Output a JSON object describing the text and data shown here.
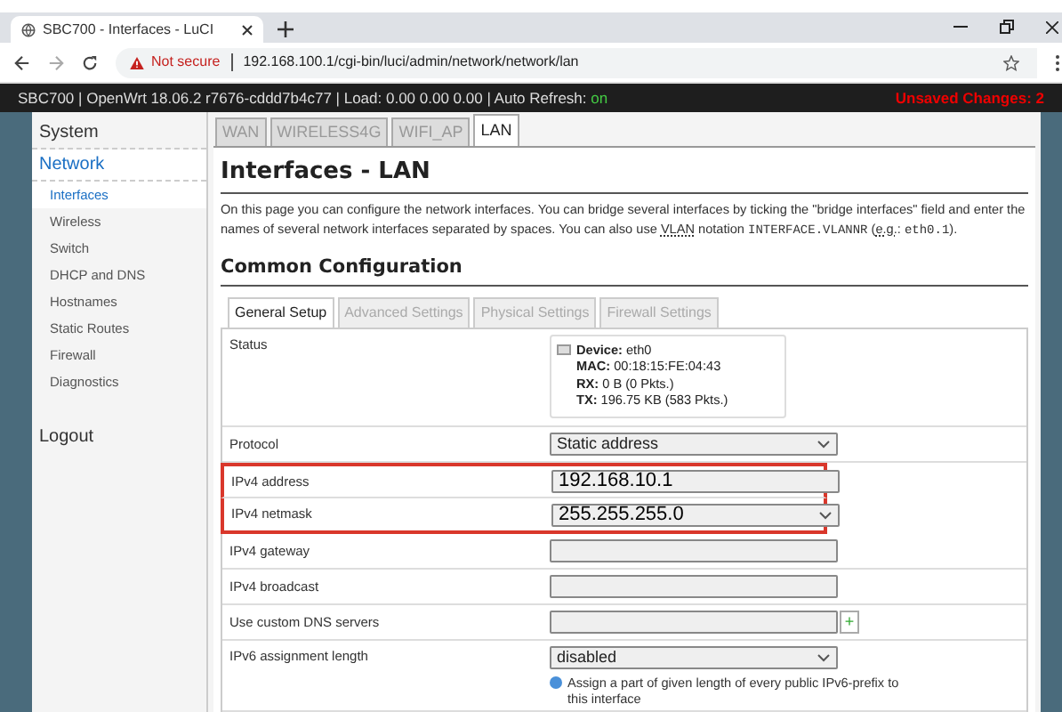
{
  "browser": {
    "tab_title": "SBC700 - Interfaces - LuCI",
    "security": "Not secure",
    "url": "192.168.100.1/cgi-bin/luci/admin/network/network/lan"
  },
  "header": {
    "info": "SBC700 | OpenWrt 18.06.2 r7676-cddd7b4c77 | Load: 0.00 0.00 0.00 | Auto Refresh: ",
    "auto_refresh": "on",
    "unsaved": "Unsaved Changes: 2"
  },
  "sidebar": {
    "items": [
      {
        "label": "System",
        "selected": false
      },
      {
        "label": "Network",
        "selected": true,
        "children": [
          {
            "label": "Interfaces",
            "selected": true
          },
          {
            "label": "Wireless",
            "selected": false
          },
          {
            "label": "Switch",
            "selected": false
          },
          {
            "label": "DHCP and DNS",
            "selected": false
          },
          {
            "label": "Hostnames",
            "selected": false
          },
          {
            "label": "Static Routes",
            "selected": false
          },
          {
            "label": "Firewall",
            "selected": false
          },
          {
            "label": "Diagnostics",
            "selected": false
          }
        ]
      }
    ],
    "logout": "Logout"
  },
  "interface_tabs": [
    {
      "label": "WAN",
      "selected": false
    },
    {
      "label": "WIRELESS4G",
      "selected": false
    },
    {
      "label": "WIFI_AP",
      "selected": false
    },
    {
      "label": "LAN",
      "selected": true
    }
  ],
  "title": "Interfaces - LAN",
  "description": [
    {
      "kind": "text",
      "text": "On this page you can configure the network interfaces. You can bridge several interfaces by ticking the \"bridge interfaces\" field and enter the names of several network interfaces separated by spaces. You can also use "
    },
    {
      "kind": "abbr",
      "text": "VLAN"
    },
    {
      "kind": "text",
      "text": " notation "
    },
    {
      "kind": "code",
      "text": "INTERFACE.VLANNR"
    },
    {
      "kind": "text",
      "text": " ("
    },
    {
      "kind": "abbr",
      "text": "e.g."
    },
    {
      "kind": "text",
      "text": ": "
    },
    {
      "kind": "code",
      "text": "eth0.1"
    },
    {
      "kind": "text",
      "text": ")."
    }
  ],
  "section_title": "Common Configuration",
  "section_tabs": [
    {
      "label": "General Setup",
      "selected": true
    },
    {
      "label": "Advanced Settings",
      "selected": false
    },
    {
      "label": "Physical Settings",
      "selected": false
    },
    {
      "label": "Firewall Settings",
      "selected": false
    }
  ],
  "status": {
    "label": "Status",
    "lines": [
      {
        "key": "Device:",
        "value": " eth0"
      },
      {
        "key": "MAC:",
        "value": " 00:18:15:FE:04:43"
      },
      {
        "key": "RX:",
        "value": " 0 B (0 Pkts.)"
      },
      {
        "key": "TX:",
        "value": " 196.75 KB (583 Pkts.)"
      }
    ]
  },
  "fields": [
    {
      "label": "Protocol",
      "kind": "select",
      "value": "Static address",
      "highlighted": false
    },
    {
      "label": "IPv4 address",
      "kind": "input",
      "value": "192.168.10.1",
      "highlighted": true
    },
    {
      "label": "IPv4 netmask",
      "kind": "select",
      "value": "255.255.255.0",
      "highlighted": true
    },
    {
      "label": "IPv4 gateway",
      "kind": "input",
      "highlighted": false
    },
    {
      "label": "IPv4 broadcast",
      "kind": "input",
      "highlighted": false
    },
    {
      "label": "Use custom DNS servers",
      "kind": "dynlist",
      "add": "+",
      "highlighted": false
    },
    {
      "label": "IPv6 assignment length",
      "kind": "select",
      "value": "disabled",
      "hint": "Assign a part of given length of every public IPv6-prefix to this interface",
      "highlighted": false
    }
  ]
}
